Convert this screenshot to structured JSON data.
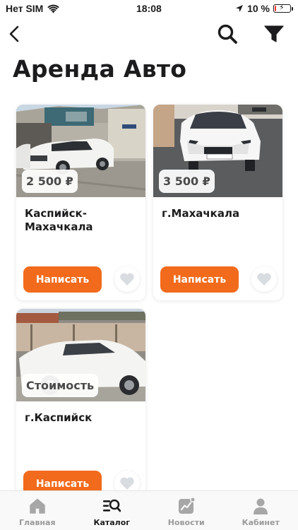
{
  "status_bar": {
    "carrier": "Нет SIM",
    "time": "18:08",
    "battery_percent": "10 %",
    "battery_level": 0.1
  },
  "nav": {
    "back_icon": "chevron-left-icon",
    "search_icon": "search-icon",
    "filter_icon": "filter-icon"
  },
  "page_title": "Аренда Авто",
  "listings": [
    {
      "price": "2 500 ₽",
      "city": "Каспийск-Махачкала",
      "button": "Написать"
    },
    {
      "price": "3 500 ₽",
      "city": "г.Махачкала",
      "button": "Написать"
    },
    {
      "price": "Стоимость",
      "city": "г.Каспийск",
      "button": "Написать"
    }
  ],
  "tabs": [
    {
      "label": "Главная",
      "icon": "home-icon",
      "active": false
    },
    {
      "label": "Каталог",
      "icon": "catalog-search-icon",
      "active": true
    },
    {
      "label": "Новости",
      "icon": "news-chart-icon",
      "active": false
    },
    {
      "label": "Кабинет",
      "icon": "user-icon",
      "active": false
    }
  ],
  "colors": {
    "accent": "#f26a1b",
    "text": "#1c1c1e",
    "tab_inactive": "#9a9a9a"
  }
}
